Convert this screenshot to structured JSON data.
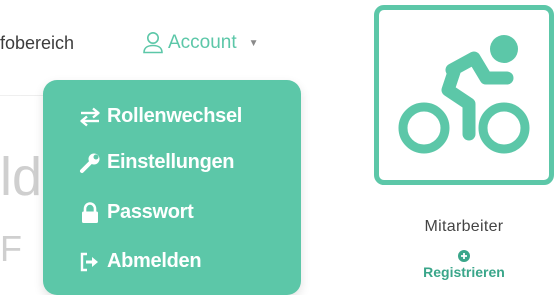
{
  "nav": {
    "left_text": "fobereich",
    "account_label": "Account"
  },
  "background": {
    "line1": "ld GmbH",
    "line2": "F"
  },
  "dropdown": {
    "items": [
      {
        "label": "Rollenwechsel",
        "icon": "swap-icon"
      },
      {
        "label": "Einstellungen",
        "icon": "wrench-icon"
      },
      {
        "label": "Passwort",
        "icon": "lock-icon"
      },
      {
        "label": "Abmelden",
        "icon": "logout-icon"
      }
    ]
  },
  "card": {
    "icon": "bicycle-rider-icon",
    "label": "Mitarbeiter",
    "register_label": "Registrieren"
  },
  "colors": {
    "accent": "#5cc7a8",
    "accent_dark": "#3aa68a",
    "background_text": "#cfcfcf"
  }
}
